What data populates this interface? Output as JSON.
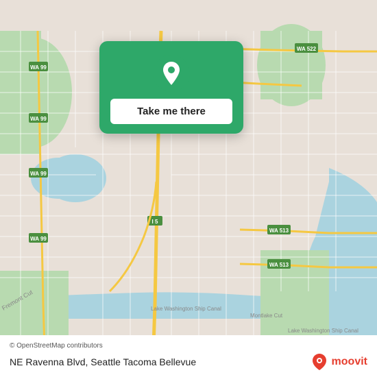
{
  "map": {
    "attribution": "© OpenStreetMap contributors",
    "location_label": "NE Ravenna Blvd, Seattle Tacoma Bellevue"
  },
  "card": {
    "button_label": "Take me there"
  },
  "moovit": {
    "logo_text": "moovit"
  }
}
